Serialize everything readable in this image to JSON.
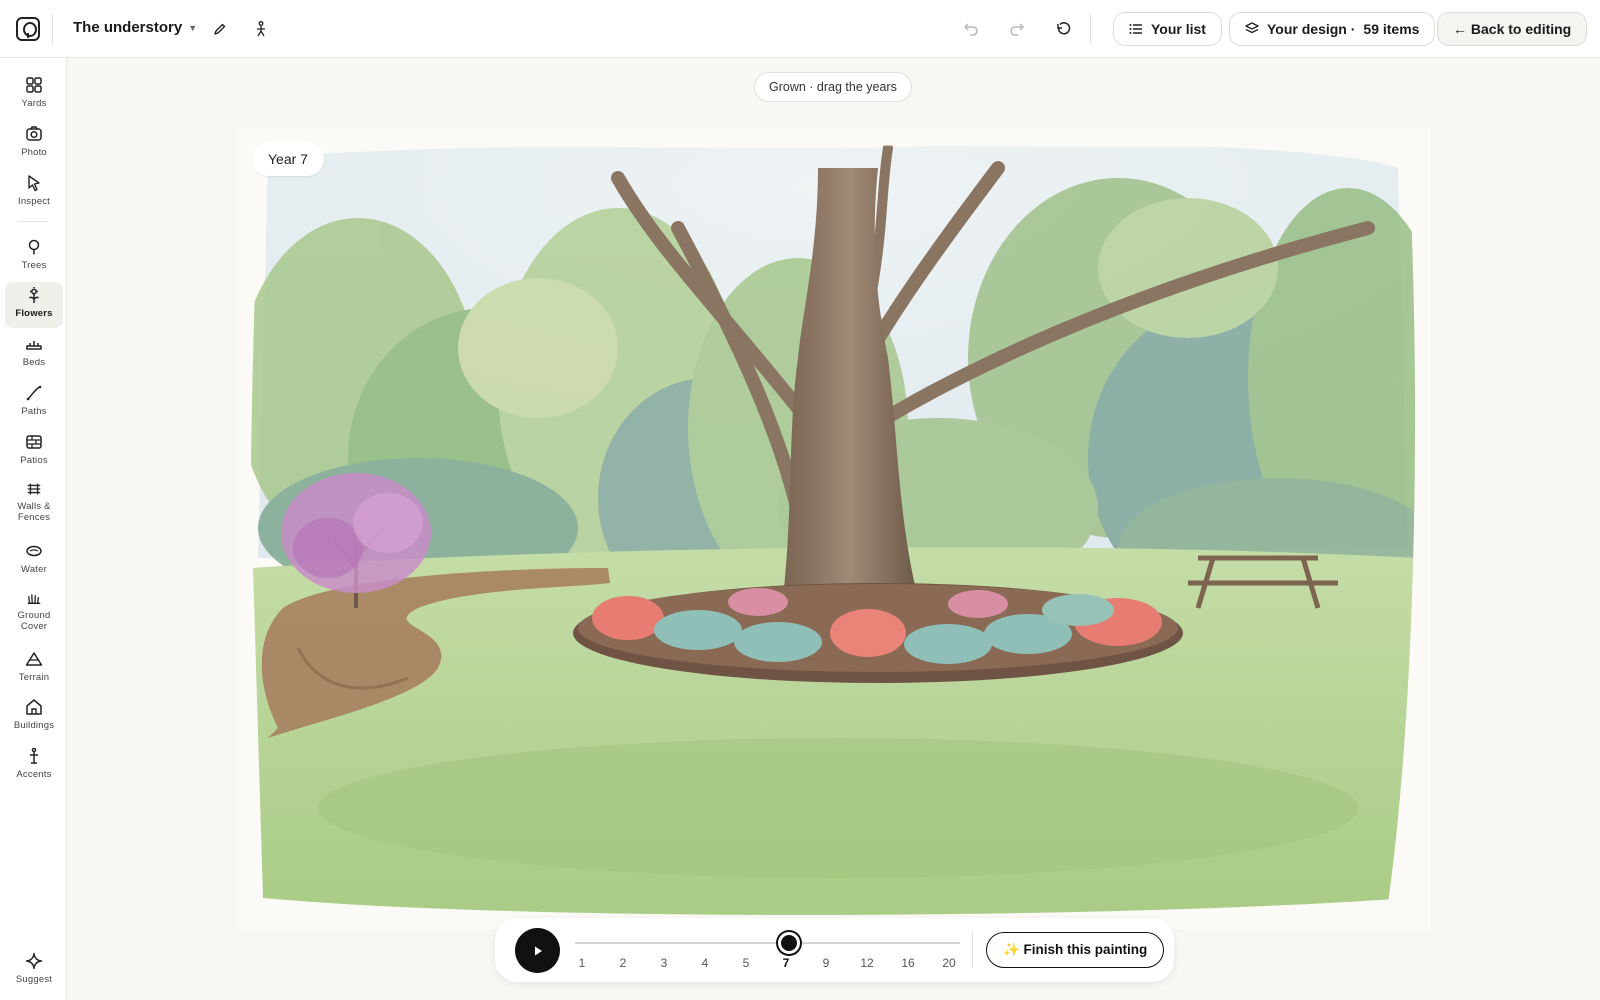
{
  "header": {
    "project_name": "The understory",
    "undo_label": "Undo",
    "your_list": "Your list",
    "your_design": "Your design ·",
    "item_count": "59 items",
    "back": "← Back to editing"
  },
  "sidebar": {
    "items": [
      {
        "label": "Yards",
        "icon": "grid-icon"
      },
      {
        "label": "Photo",
        "icon": "camera-icon"
      },
      {
        "label": "Inspect",
        "icon": "cursor-icon"
      },
      {
        "label": "Trees",
        "icon": "tree-icon"
      },
      {
        "label": "Flowers",
        "icon": "flower-icon",
        "active": true
      },
      {
        "label": "Beds",
        "icon": "bed-icon"
      },
      {
        "label": "Paths",
        "icon": "path-icon"
      },
      {
        "label": "Patios",
        "icon": "patio-icon"
      },
      {
        "label": "Walls & Fences",
        "icon": "fence-icon"
      },
      {
        "label": "Water",
        "icon": "water-icon"
      },
      {
        "label": "Ground Cover",
        "icon": "grass-icon"
      },
      {
        "label": "Terrain",
        "icon": "terrain-icon"
      },
      {
        "label": "Buildings",
        "icon": "house-icon"
      },
      {
        "label": "Accents",
        "icon": "accent-icon"
      }
    ],
    "suggest": "Suggest"
  },
  "canvas": {
    "hint": "Grown · drag the years",
    "year_badge": "Year 7"
  },
  "timeline": {
    "years": [
      "1",
      "2",
      "3",
      "4",
      "5",
      "7",
      "9",
      "12",
      "16",
      "20"
    ],
    "selected_year": "7",
    "finish_label": "✨ Finish this painting"
  },
  "colors": {
    "accent": "#111111",
    "active_tool_bg": "#eef0ea"
  }
}
